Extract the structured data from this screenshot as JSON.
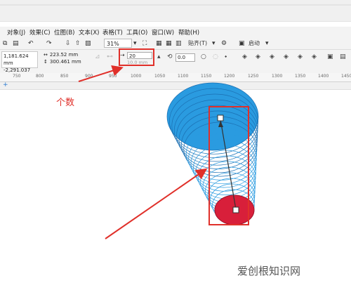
{
  "menu": [
    "对象(J)",
    "效果(C)",
    "位图(B)",
    "文本(X)",
    "表格(T)",
    "工具(O)",
    "窗口(W)",
    "帮助(H)"
  ],
  "toolbar": {
    "zoom": "31%",
    "snap_label": "贴齐(T)",
    "launch_label": "启动"
  },
  "property_bar": {
    "x": "1,181.624 mm",
    "y": "-2,291.037 mm",
    "width": "223.52 mm",
    "height": "300.461 mm",
    "steps": "20",
    "spacing": "10.0 mm",
    "angle": "0.0"
  },
  "ruler_ticks": [
    "750",
    "800",
    "850",
    "900",
    "950",
    "1000",
    "1050",
    "1100",
    "1150",
    "1200",
    "1250",
    "1300",
    "1350",
    "1400",
    "1450"
  ],
  "annotation": "个数",
  "watermark": "爱创根知识网",
  "colors": {
    "accent_red": "#e0302a",
    "blue_fill": "#2a9be0",
    "red_ellipse": "#d81f3a"
  }
}
